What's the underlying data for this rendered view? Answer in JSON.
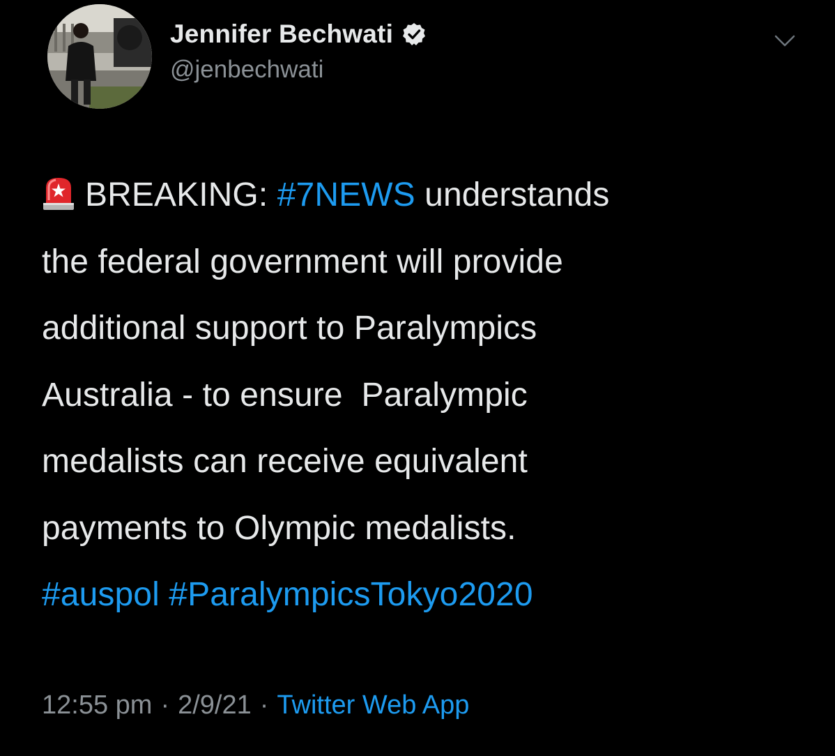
{
  "tweet": {
    "author": {
      "display_name": "Jennifer Bechwati",
      "handle": "@jenbechwati",
      "verified_icon": "verified-badge-icon",
      "avatar_icon": "profile-photo"
    },
    "more_icon": "chevron-down-icon",
    "emoji_icon": "police-siren-icon",
    "text_lines": [
      [
        {
          "t": "BREAKING: ",
          "tag": false
        },
        {
          "t": "#7NEWS",
          "tag": true
        },
        {
          "t": " understands",
          "tag": false
        }
      ],
      [
        {
          "t": "the federal government will provide",
          "tag": false
        }
      ],
      [
        {
          "t": "additional support to Paralympics",
          "tag": false
        }
      ],
      [
        {
          "t": "Australia - to ensure  Paralympic",
          "tag": false
        }
      ],
      [
        {
          "t": "medalists can receive equivalent",
          "tag": false
        }
      ],
      [
        {
          "t": "payments to Olympic medalists.",
          "tag": false
        }
      ],
      [
        {
          "t": "#auspol",
          "tag": true
        },
        {
          "t": " ",
          "tag": false
        },
        {
          "t": "#ParalympicsTokyo2020",
          "tag": true
        }
      ]
    ],
    "time": "12:55 pm",
    "date": "2/9/21",
    "separator": "·",
    "source": "Twitter Web App"
  },
  "colors": {
    "background": "#000000",
    "text": "#e7e9ea",
    "secondary": "#8b9196",
    "link": "#1d9bf0"
  }
}
